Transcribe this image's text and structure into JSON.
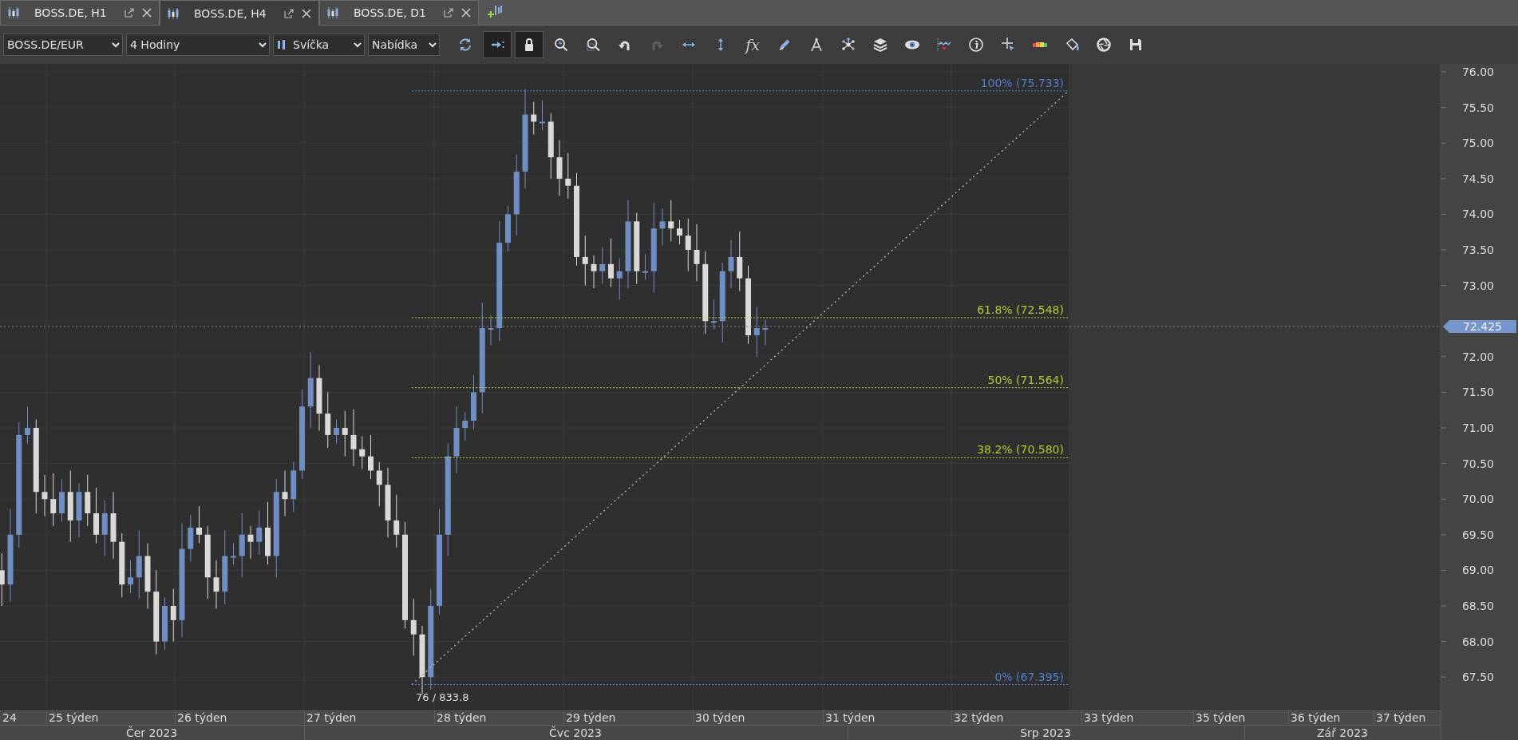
{
  "tabs": [
    {
      "label": "BOSS.DE, H1",
      "selected": false
    },
    {
      "label": "BOSS.DE, H4",
      "selected": true
    },
    {
      "label": "BOSS.DE, D1",
      "selected": false
    }
  ],
  "toolbar": {
    "symbol": "BOSS.DE/EUR",
    "timeframe": "4 Hodiny",
    "chart_type": "Svíčka",
    "price_type": "Nabídka",
    "tools": [
      {
        "kind": "refresh",
        "on": false,
        "disabled": false
      },
      {
        "kind": "scroll-end",
        "on": true,
        "disabled": false
      },
      {
        "kind": "lock",
        "on": true,
        "disabled": false
      },
      {
        "kind": "zoom-in",
        "on": false,
        "disabled": false
      },
      {
        "kind": "zoom-out",
        "on": false,
        "disabled": false
      },
      {
        "kind": "undo",
        "on": false,
        "disabled": false
      },
      {
        "kind": "redo",
        "on": false,
        "disabled": true
      },
      {
        "kind": "fit-horizontal",
        "on": false,
        "disabled": false
      },
      {
        "kind": "fit-vertical",
        "on": false,
        "disabled": false
      },
      {
        "kind": "indicators",
        "label": "fx",
        "on": false,
        "disabled": false
      },
      {
        "kind": "pencil",
        "on": false,
        "disabled": false
      },
      {
        "kind": "compass",
        "on": false,
        "disabled": false
      },
      {
        "kind": "objects",
        "on": false,
        "disabled": false
      },
      {
        "kind": "layers",
        "on": false,
        "disabled": false
      },
      {
        "kind": "eye",
        "on": false,
        "disabled": false
      },
      {
        "kind": "signal",
        "on": false,
        "disabled": false
      },
      {
        "kind": "info",
        "on": false,
        "disabled": false
      },
      {
        "kind": "crosshair",
        "on": false,
        "disabled": false
      },
      {
        "kind": "color-bar",
        "on": false,
        "disabled": false
      },
      {
        "kind": "paint-bucket",
        "on": false,
        "disabled": false
      },
      {
        "kind": "shutter",
        "on": false,
        "disabled": false
      },
      {
        "kind": "save",
        "on": false,
        "disabled": false
      }
    ]
  },
  "chart": {
    "price_axis": [
      "76.00",
      "75.50",
      "75.00",
      "74.50",
      "74.00",
      "73.50",
      "73.00",
      "72.00",
      "71.50",
      "71.00",
      "70.50",
      "70.00",
      "69.50",
      "69.00",
      "68.50",
      "68.00",
      "67.50"
    ],
    "current_price": "72.425",
    "fib_levels": [
      {
        "label": "100% (75.733)",
        "color": "#4a7fd0"
      },
      {
        "label": "61.8% (72.548)",
        "color": "#b5c832"
      },
      {
        "label": "50% (71.564)",
        "color": "#b5c832"
      },
      {
        "label": "38.2% (70.580)",
        "color": "#b5c832"
      },
      {
        "label": "0% (67.395)",
        "color": "#4a7fd0"
      }
    ],
    "low_label": "76 / 833.8",
    "weeks": [
      "24",
      "25 týden",
      "26 týden",
      "27 týden",
      "28 týden",
      "29 týden",
      "30 týden",
      "31 týden",
      "32 týden",
      "33 týden",
      "35 týden",
      "36 týden",
      "37 týden"
    ],
    "months": [
      "Čer 2023",
      "Čvc 2023",
      "Srp 2023",
      "Zář 2023"
    ]
  }
}
